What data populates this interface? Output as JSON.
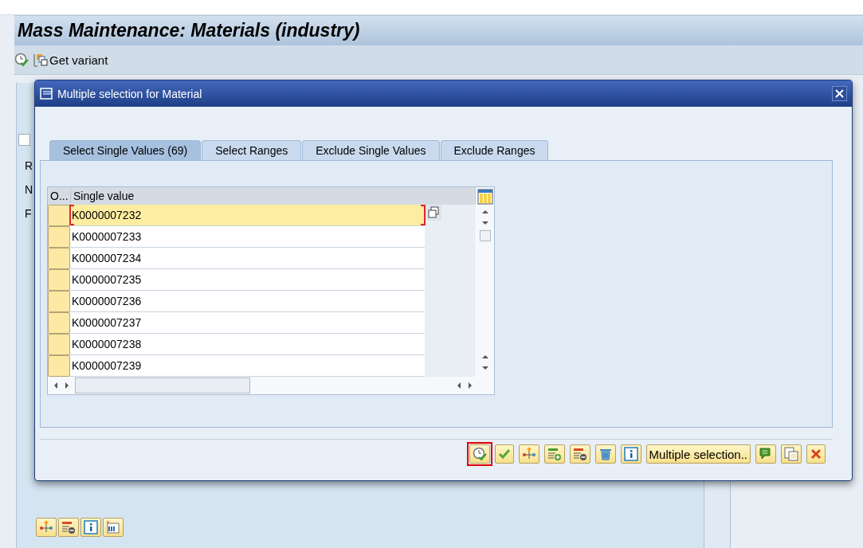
{
  "app": {
    "title": "Mass Maintenance: Materials (industry)",
    "toolbar": [
      {
        "kind": "execute"
      },
      {
        "kind": "variant",
        "label": "Get variant"
      }
    ]
  },
  "background": {
    "checkbox": {
      "checked": false
    },
    "fragments": [
      "R",
      "N",
      "F"
    ],
    "buttons": [
      {
        "kind": "hierarchy"
      },
      {
        "kind": "remove-row"
      },
      {
        "kind": "info"
      },
      {
        "kind": "table-settings"
      }
    ]
  },
  "dialog": {
    "title": "Multiple selection for Material",
    "tabs": [
      {
        "label": "Select Single Values (69)",
        "selected": true
      },
      {
        "label": "Select Ranges",
        "selected": false
      },
      {
        "label": "Exclude Single Values",
        "selected": false
      },
      {
        "label": "Exclude Ranges",
        "selected": false
      }
    ],
    "table": {
      "columns": [
        "O...",
        "Single value"
      ],
      "rows": [
        {
          "value": "K0000007232",
          "selected": true
        },
        {
          "value": "K0000007233",
          "selected": false
        },
        {
          "value": "K0000007234",
          "selected": false
        },
        {
          "value": "K0000007235",
          "selected": false
        },
        {
          "value": "K0000007236",
          "selected": false
        },
        {
          "value": "K0000007237",
          "selected": false
        },
        {
          "value": "K0000007238",
          "selected": false
        },
        {
          "value": "K0000007239",
          "selected": false
        }
      ]
    },
    "buttons": [
      {
        "kind": "execute",
        "highlighted": true
      },
      {
        "kind": "check",
        "highlighted": false
      },
      {
        "kind": "hierarchy",
        "highlighted": false
      },
      {
        "kind": "add-row",
        "highlighted": false
      },
      {
        "kind": "remove-row",
        "highlighted": false
      },
      {
        "kind": "trash",
        "highlighted": false
      },
      {
        "kind": "info",
        "highlighted": false
      },
      {
        "kind": "text",
        "label": "Multiple selection..",
        "highlighted": false
      },
      {
        "kind": "comment",
        "highlighted": false
      },
      {
        "kind": "paste",
        "highlighted": false
      },
      {
        "kind": "cancel",
        "highlighted": false
      }
    ]
  }
}
